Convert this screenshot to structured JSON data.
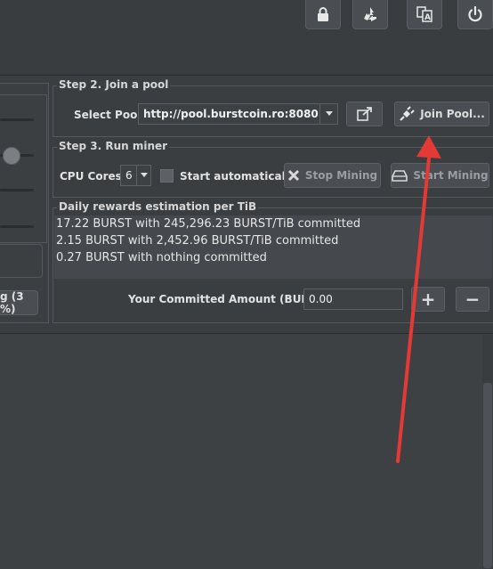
{
  "toolbar": {
    "icons": [
      "lock-icon",
      "recycle-icon",
      "translate-icon",
      "power-icon"
    ]
  },
  "left_panel": {
    "progress_button_label": "g (3 %)"
  },
  "step2": {
    "title": "Step 2. Join a pool",
    "select_pool_label": "Select Pool:",
    "pool_url": "http://pool.burstcoin.ro:8080",
    "join_pool_label": "Join Pool..."
  },
  "step3": {
    "title": "Step 3. Run miner",
    "cpu_cores_label": "CPU Cores",
    "cpu_cores_value": "6",
    "start_auto_label": "Start automatically",
    "start_auto_checked": false,
    "stop_mining_label": "Stop Mining",
    "start_mining_label": "Start Mining"
  },
  "rewards": {
    "title": "Daily rewards estimation per TiB",
    "lines": [
      "17.22 BURST with 245,296.23 BURST/TiB committed",
      "2.15 BURST with 2,452.96 BURST/TiB committed",
      "0.27 BURST with nothing committed"
    ],
    "committed_label": "Your Committed Amount (BURST):",
    "committed_value": "0.00",
    "plus_label": "+",
    "minus_label": "−"
  },
  "colors": {
    "arrow": "#e53935",
    "background": "#3b3e41"
  }
}
